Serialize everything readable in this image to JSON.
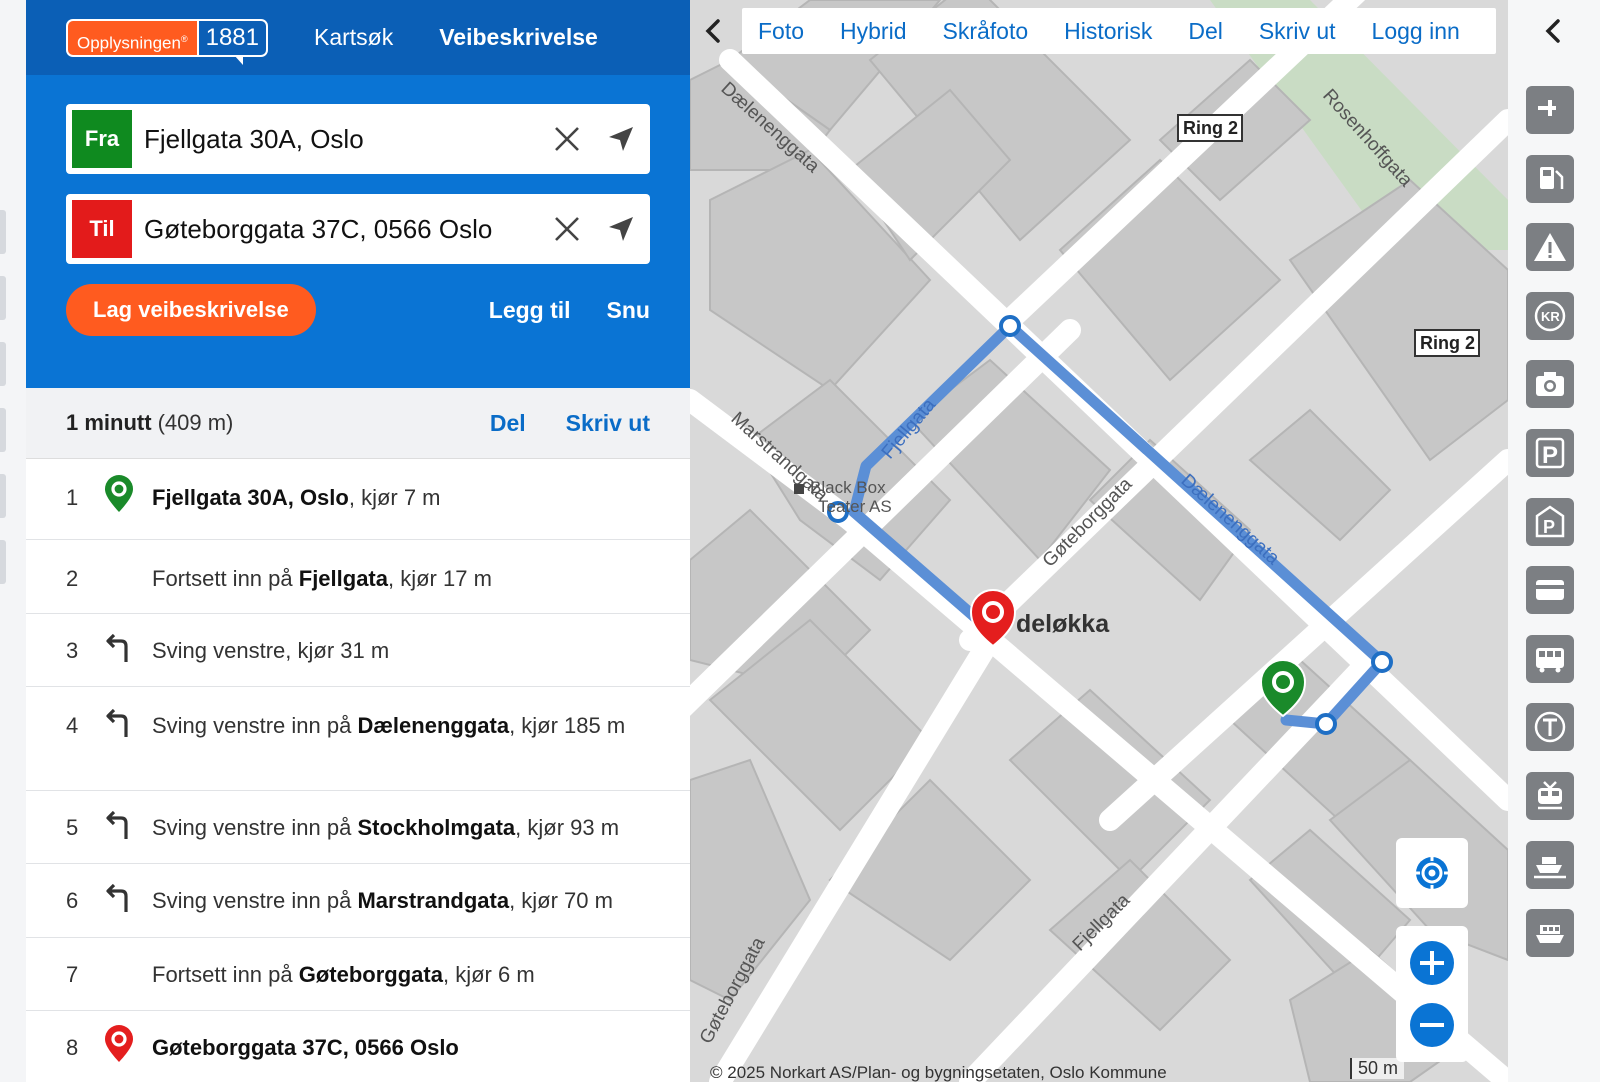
{
  "header": {
    "logo_text": "Opplysningen",
    "logo_reg": "®",
    "logo_num": "1881",
    "nav": [
      "Kartsøk",
      "Veibeskrivelse"
    ]
  },
  "route_form": {
    "from_tag": "Fra",
    "from_value": "Fjellgata 30A, Oslo",
    "to_tag": "Til",
    "to_value": "Gøteborggata 37C, 0566 Oslo",
    "go_label": "Lag veibeskrivelse",
    "add_label": "Legg til",
    "swap_label": "Snu"
  },
  "summary": {
    "time": "1 minutt",
    "distance": "(409 m)",
    "share_label": "Del",
    "print_label": "Skriv ut"
  },
  "steps": [
    {
      "num": "1",
      "icon": "start-pin-icon",
      "text_html": "<b>Fjellgata 30A, Oslo</b>, kjør 7 m"
    },
    {
      "num": "2",
      "icon": "none",
      "text_html": "Fortsett inn på <b>Fjellgata</b>, kjør 17 m"
    },
    {
      "num": "3",
      "icon": "turn-left-icon",
      "text_html": "Sving venstre, kjør 31 m"
    },
    {
      "num": "4",
      "icon": "turn-left-icon",
      "text_html": "Sving venstre inn på <b>Dælenenggata</b>, kjør 185 m"
    },
    {
      "num": "5",
      "icon": "turn-left-icon",
      "text_html": "Sving venstre inn på <b>Stockholmgata</b>, kjør 93 m"
    },
    {
      "num": "6",
      "icon": "turn-left-icon",
      "text_html": "Sving venstre inn på <b>Marstrandgata</b>, kjør 70 m"
    },
    {
      "num": "7",
      "icon": "none",
      "text_html": "Fortsett inn på <b>Gøteborggata</b>, kjør 6 m"
    },
    {
      "num": "8",
      "icon": "end-pin-icon",
      "text_html": "<b>Gøteborggata 37C, 0566 Oslo</b>"
    }
  ],
  "map": {
    "tabs": [
      "Foto",
      "Hybrid",
      "Skråfoto",
      "Historisk",
      "Del",
      "Skriv ut",
      "Logg inn"
    ],
    "street_labels": [
      "Dælenenggata",
      "Marstrandgata",
      "Gøteborggata",
      "Dælenenggata",
      "Rosenhoffgata",
      "Fjellgata",
      "Gøteborggata",
      "Fjellgata"
    ],
    "place_label": "Grünerløkka",
    "place_visible": "deløkka",
    "poi": [
      "Black Box",
      "Teater AS"
    ],
    "ring_labels": [
      "Ring 2",
      "Ring 2"
    ],
    "copyright": "© 2025 Norkart AS/Plan- og bygningsetaten, Oslo Kommune",
    "scale": "50 m",
    "route_color": "#5b8fd6",
    "start_color": "#1a8a2a",
    "end_color": "#e41e1e"
  },
  "toolbar": {
    "tools": [
      "ev-charger-icon",
      "fuel-icon",
      "warning-icon",
      "kr-toll-icon",
      "camera-icon",
      "parking-icon",
      "parking-garage-icon",
      "card-icon",
      "bus-icon",
      "tram-icon",
      "train-icon",
      "boat-icon",
      "ferry-icon"
    ]
  }
}
